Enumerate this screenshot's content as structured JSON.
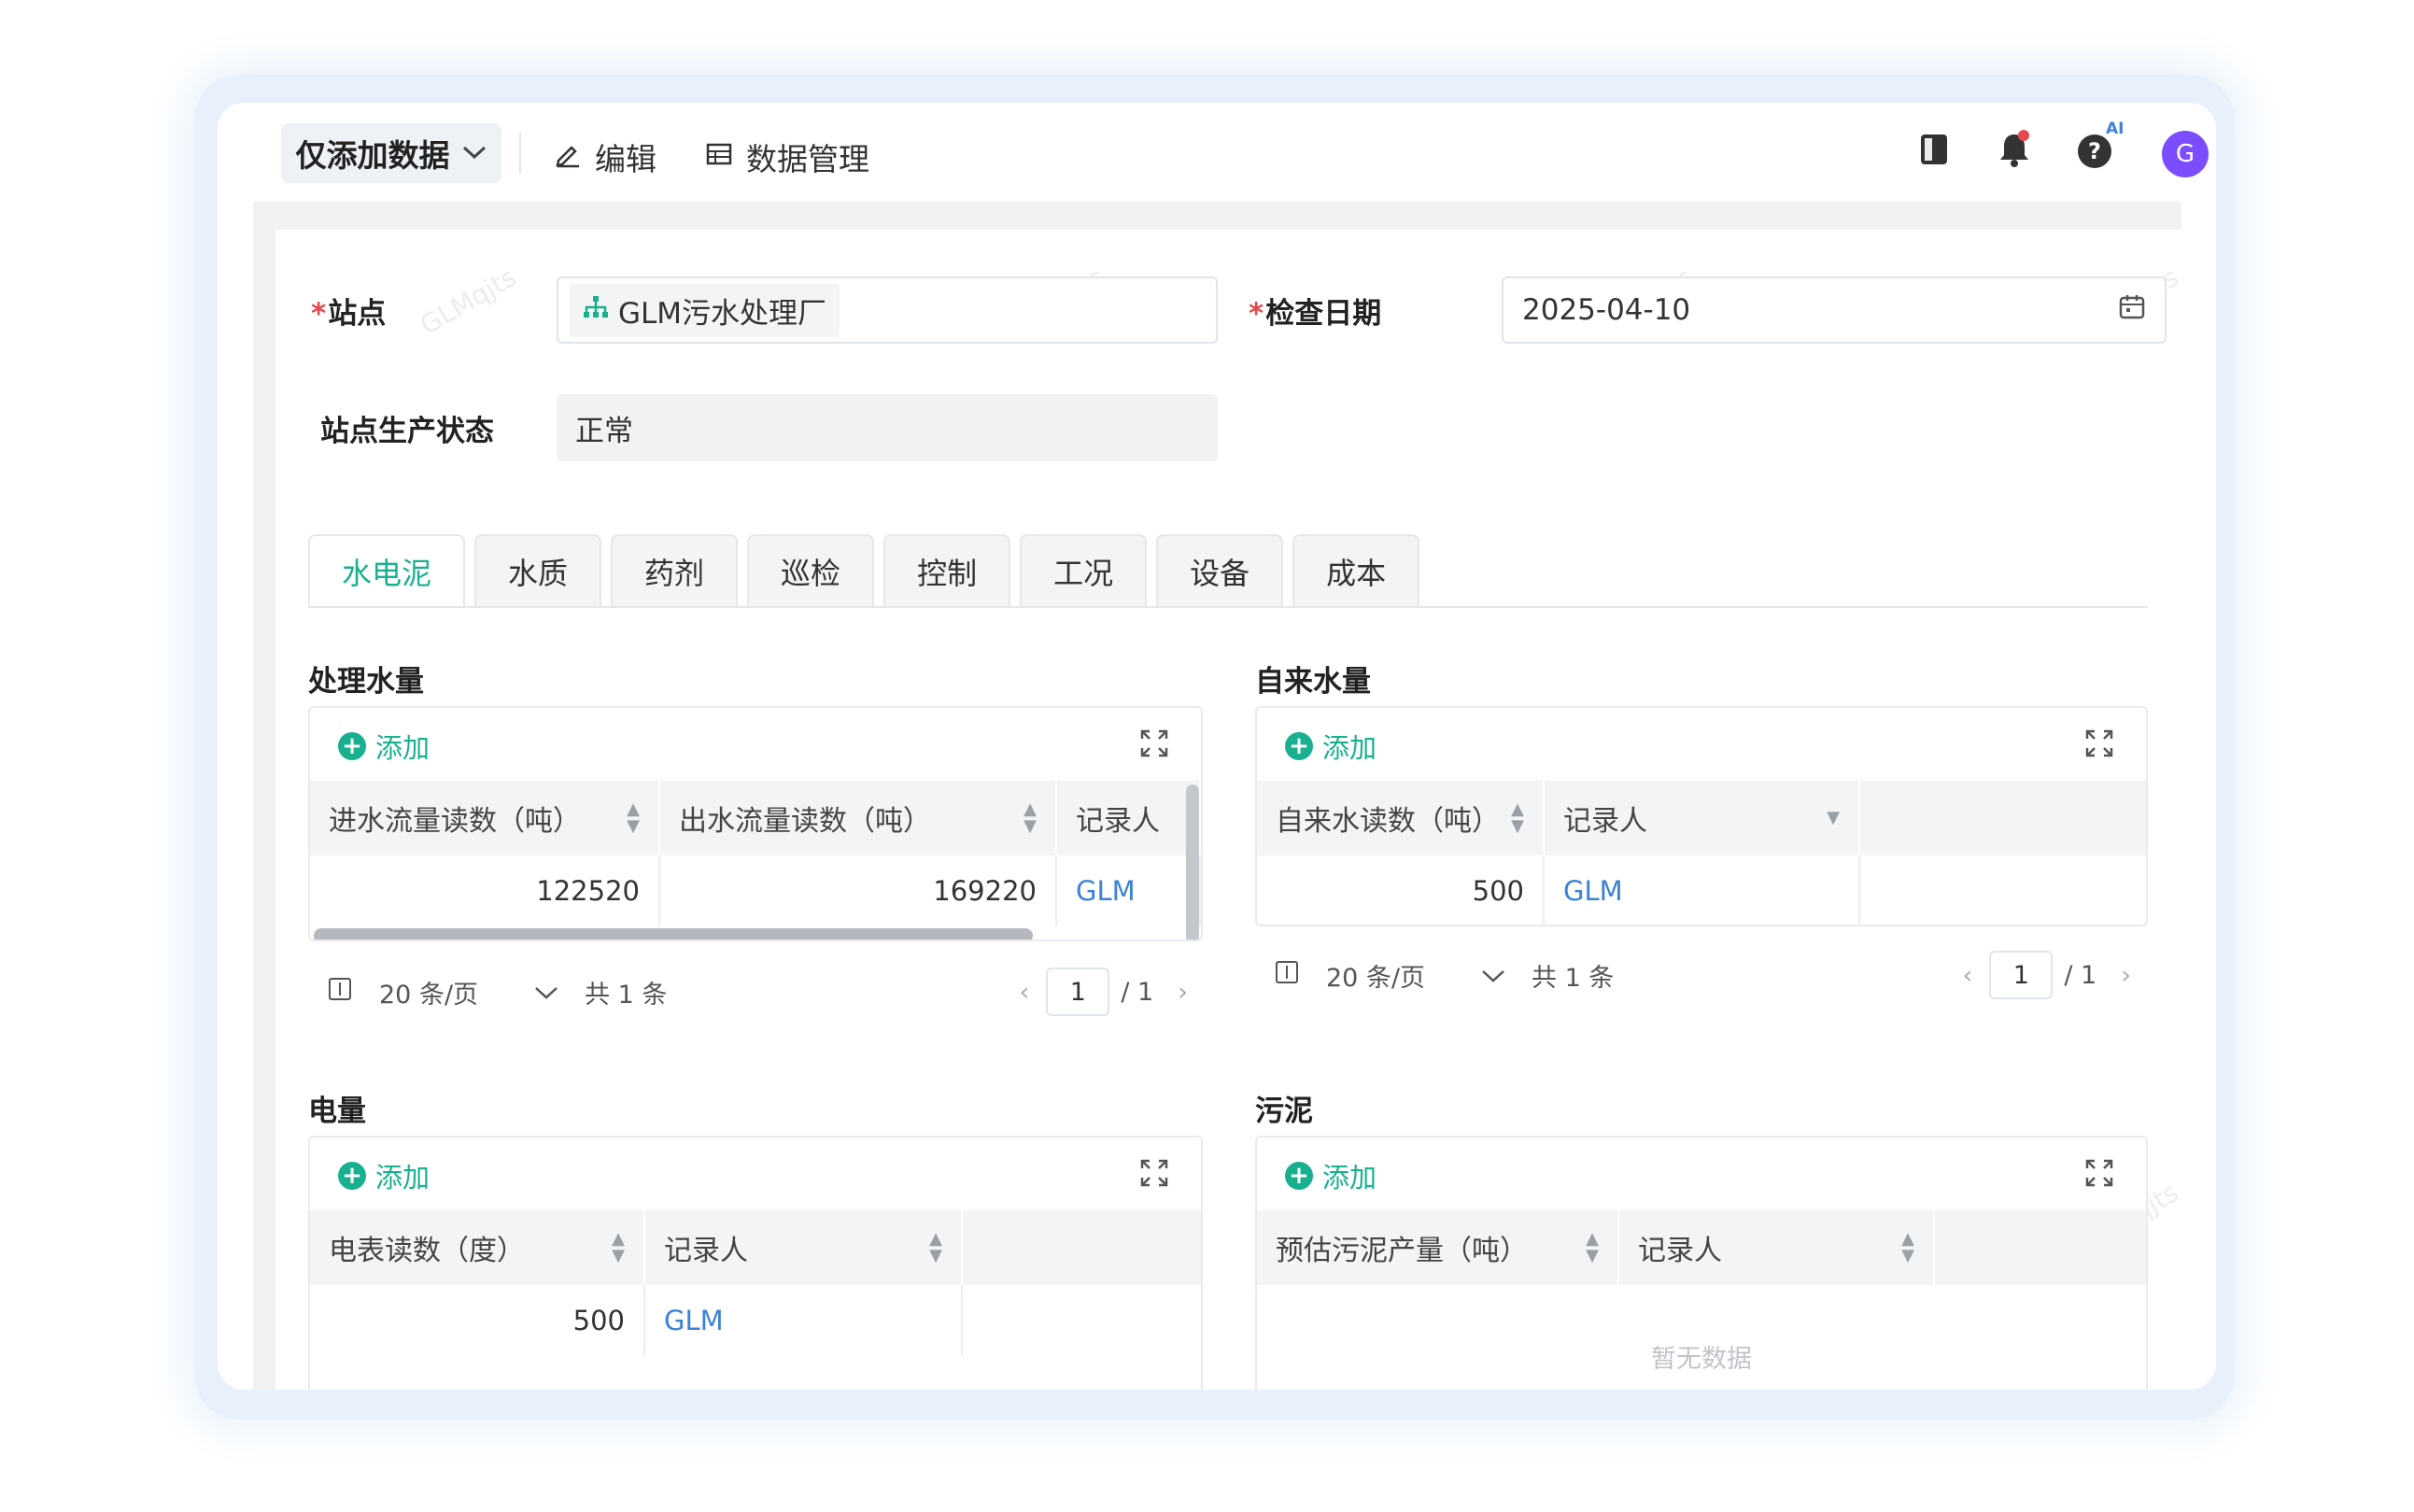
{
  "toolbar": {
    "mode_label": "仅添加数据",
    "edit_label": "编辑",
    "data_mgmt_label": "数据管理",
    "ai_badge": "AI",
    "avatar_letter": "G"
  },
  "form": {
    "site_label": "站点",
    "site_value": "GLM污水处理厂",
    "date_label": "检查日期",
    "date_value": "2025-04-10",
    "status_label": "站点生产状态",
    "status_value": "正常"
  },
  "tabs": [
    {
      "label": "水电泥",
      "active": true
    },
    {
      "label": "水质"
    },
    {
      "label": "药剂"
    },
    {
      "label": "巡检"
    },
    {
      "label": "控制"
    },
    {
      "label": "工况"
    },
    {
      "label": "设备"
    },
    {
      "label": "成本"
    }
  ],
  "common": {
    "add_label": "添加",
    "page_size": "20 条/页",
    "total": "共 1 条",
    "page_current": "1",
    "page_total": "/ 1",
    "watermark": "GLMqjts"
  },
  "sections": {
    "water": {
      "title": "处理水量",
      "headers": [
        "进水流量读数（吨）",
        "出水流量读数（吨）",
        "记录人"
      ],
      "rows": [
        [
          "122520",
          "169220",
          "GLM"
        ]
      ]
    },
    "tap": {
      "title": "自来水量",
      "headers": [
        "自来水读数（吨）",
        "记录人"
      ],
      "rows": [
        [
          "500",
          "GLM"
        ]
      ]
    },
    "power": {
      "title": "电量",
      "headers": [
        "电表读数（度）",
        "记录人"
      ],
      "rows": [
        [
          "500",
          "GLM"
        ]
      ]
    },
    "sludge": {
      "title": "污泥",
      "headers": [
        "预估污泥产量（吨）",
        "记录人"
      ],
      "empty_text": "暂无数据"
    }
  },
  "colors": {
    "accent": "#18b08f",
    "link": "#3b82d6",
    "required": "#e5484d",
    "avatar": "#7c4dff"
  }
}
